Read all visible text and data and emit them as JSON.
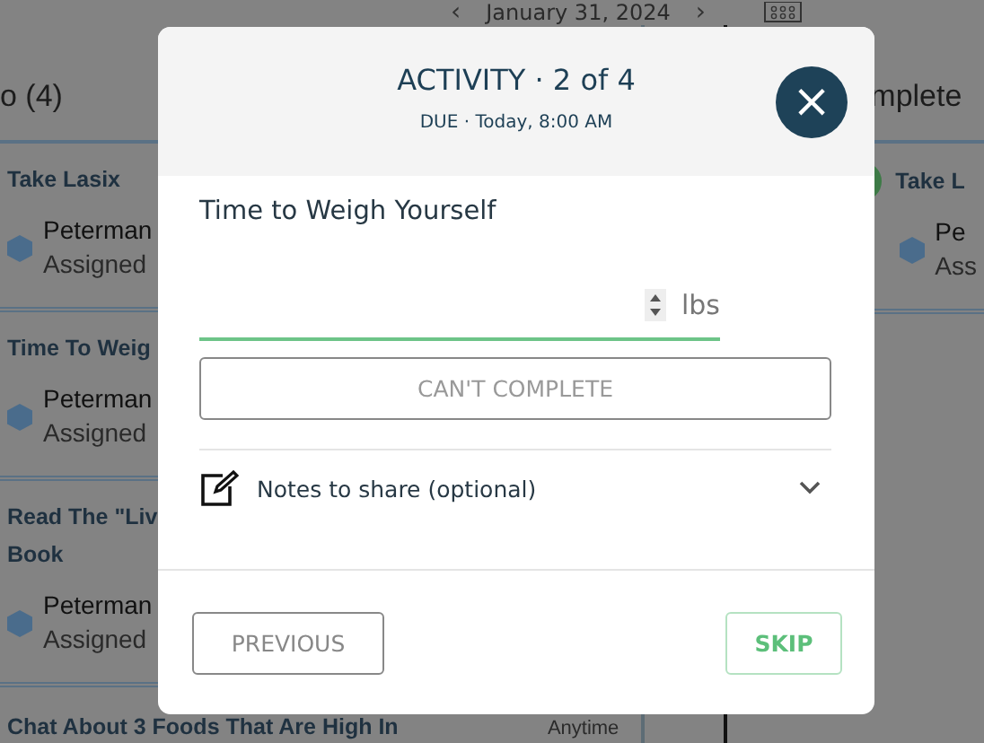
{
  "header": {
    "prev": "‹",
    "date": "January 31, 2024",
    "next": "›"
  },
  "left_column": {
    "title": "o (4)",
    "items": [
      {
        "title": "Take Lasix",
        "lines": [
          "Peterman",
          "Assigned"
        ]
      },
      {
        "title": "Time To Weig",
        "lines": [
          "Peterman",
          "Assigned"
        ]
      },
      {
        "title": "Read The \"Liv",
        "title_2": "Book",
        "lines": [
          "Peterman",
          "Assigned"
        ]
      },
      {
        "title": "Chat About 3 Foods That Are High In",
        "time": "Anytime"
      }
    ]
  },
  "right_column": {
    "title": "mplete",
    "items": [
      {
        "title": "Take L",
        "completed": true,
        "lines": [
          "Pe",
          "Ass"
        ]
      }
    ]
  },
  "modal": {
    "title": "ACTIVITY · 2 of 4",
    "due": "DUE · Today, 8:00 AM",
    "close": "×",
    "question": "Time to Weigh Yourself",
    "unit": "lbs",
    "cant_complete": "CAN'T COMPLETE",
    "notes": {
      "label": "Notes to share (optional)",
      "expanded": false
    },
    "previous": "PREVIOUS",
    "skip": "SKIP"
  }
}
